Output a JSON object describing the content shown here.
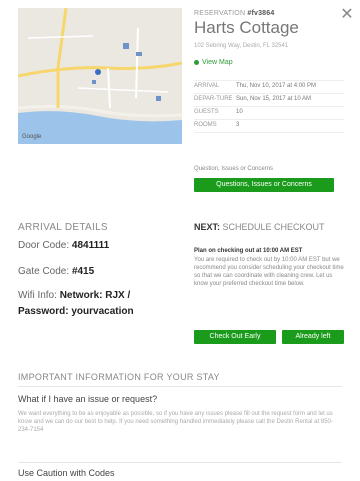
{
  "header": {
    "reservation_prefix": "RESERVATION",
    "reservation_number": "#fv3864",
    "property_name": "Harts Cottage",
    "address": "102 Sebring Way, Destin, FL 32541",
    "view_map": "View Map"
  },
  "close_glyph": "✕",
  "details": [
    {
      "key": "Arrival",
      "value": "Thu, Nov 10, 2017 at 4:00 PM"
    },
    {
      "key": "Depar-ture",
      "value": "Sun, Nov 15, 2017 at 10 AM"
    },
    {
      "key": "Guests",
      "value": "10"
    },
    {
      "key": "Rooms",
      "value": "3"
    }
  ],
  "questions": {
    "label": "Question, Issues or Concerns",
    "button": "Questions, Issues or Concerns"
  },
  "arrival": {
    "title": "ARRIVAL DETAILS",
    "door_label": "Door Code:",
    "door_value": "4841111",
    "gate_label": "Gate Code:",
    "gate_value": "#415",
    "wifi_label": "Wifi Info:",
    "wifi_network": "Network: RJX /",
    "wifi_password": "Password: yourvacation"
  },
  "next": {
    "prefix": "NEXT:",
    "title": "SCHEDULE CHECKOUT",
    "subtitle": "Plan on checking out at 10:00 AM EST",
    "body": "You are required to check out by 10:00 AM EST but we recommend you consider scheduling your checkout time so that we can coordinate with cleaning crew. Let us know your preferred checkout time below.",
    "checkout_button": "Check Out Early",
    "leave_button": "Already left"
  },
  "important": {
    "title": "IMPORTANT INFORMATION FOR YOUR STAY",
    "faq1_q": "What if I have an issue or request?",
    "faq1_a": "We want everything to be as enjoyable as possible, so if you have any issues please fill out the request form and let us know and we can do our best to help. If you need something handled immediately please call the Destin Rental at 850-234-7154",
    "faq2_q": "Use Caution with Codes"
  },
  "colors": {
    "accent": "#1b9b1b",
    "map_bg": "#e9e6df",
    "water": "#8fb8e6"
  },
  "icons": [
    "close-icon",
    "map-pin-icon"
  ]
}
